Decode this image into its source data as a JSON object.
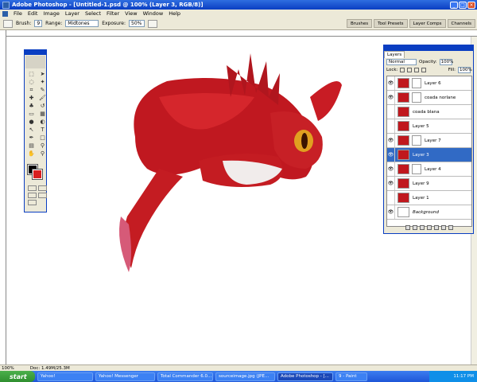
{
  "titlebar": {
    "title": "Adobe Photoshop - [Untitled-1.psd @ 100% (Layer 3, RGB/8)]"
  },
  "menu": [
    "File",
    "Edit",
    "Image",
    "Layer",
    "Select",
    "Filter",
    "View",
    "Window",
    "Help"
  ],
  "options": {
    "brush_label": "Brush:",
    "brush_size": "9",
    "range_label": "Range:",
    "range_value": "Midtones",
    "exposure_label": "Exposure:",
    "exposure_value": "50%"
  },
  "palette_well": [
    "Brushes",
    "Tool Presets",
    "Layer Comps",
    "Channels"
  ],
  "layers_panel": {
    "tab": "Layers",
    "blend_mode": "Normal",
    "opacity_label": "Opacity:",
    "opacity_value": "100%",
    "lock_label": "Lock:",
    "fill_label": "Fill:",
    "fill_value": "100%",
    "items": [
      {
        "name": "Layer 6",
        "visible": true,
        "mask": true,
        "selected": false
      },
      {
        "name": "coada norlane",
        "visible": true,
        "mask": true,
        "selected": false
      },
      {
        "name": "coada blana",
        "visible": false,
        "mask": false,
        "selected": false
      },
      {
        "name": "Layer 5",
        "visible": false,
        "mask": false,
        "selected": false
      },
      {
        "name": "Layer 7",
        "visible": true,
        "mask": true,
        "selected": false
      },
      {
        "name": "Layer 3",
        "visible": true,
        "mask": false,
        "selected": true
      },
      {
        "name": "Layer 4",
        "visible": true,
        "mask": true,
        "selected": false
      },
      {
        "name": "Layer 9",
        "visible": true,
        "mask": false,
        "selected": false
      },
      {
        "name": "Layer 1",
        "visible": false,
        "mask": false,
        "selected": false
      },
      {
        "name": "Background",
        "visible": true,
        "mask": false,
        "selected": false
      }
    ]
  },
  "status": {
    "zoom": "100%",
    "doc": "Doc: 1.49M/25.3M"
  },
  "taskbar": {
    "start": "start",
    "tasks": [
      "Yahoo!",
      "Yahoo! Messenger",
      "Total Commander 6.0...",
      "sourceimage.jpg (JPE...",
      "Adobe Photoshop - [...",
      "9 - Paint"
    ],
    "active_task": "Adobe Photoshop - [...",
    "clock": "11:17 PM"
  },
  "colors": {
    "foreground": "#000000",
    "background": "#d92020",
    "selection": "#316ac5"
  }
}
